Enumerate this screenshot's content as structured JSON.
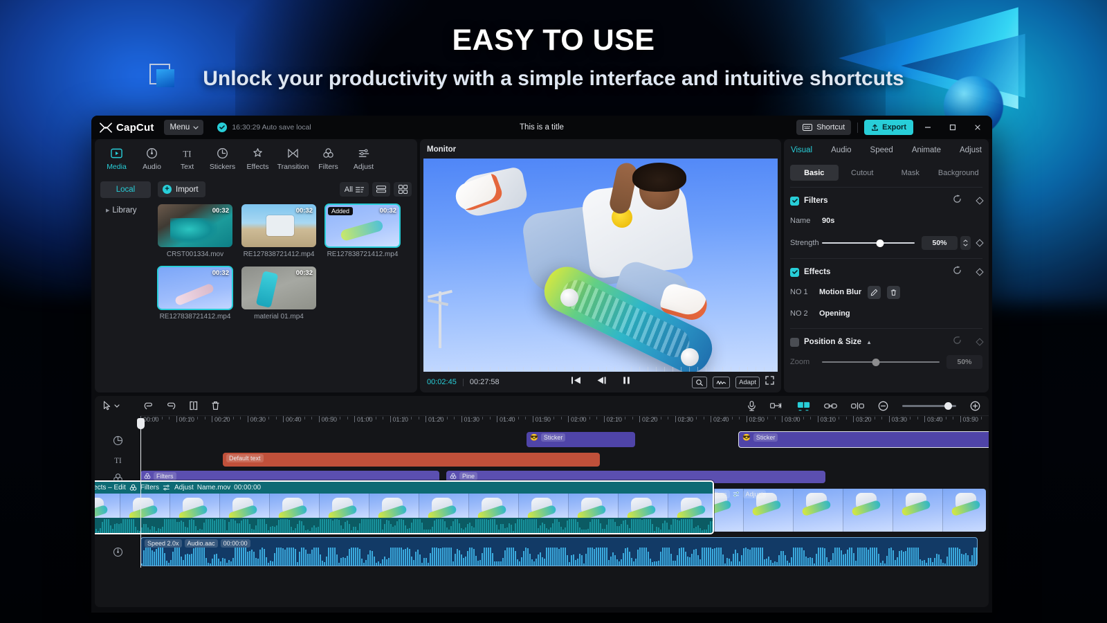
{
  "banner": {
    "headline": "EASY TO USE",
    "subhead": "Unlock your productivity with a simple interface and intuitive shortcuts"
  },
  "titlebar": {
    "brand": "CapCut",
    "menu_label": "Menu",
    "autosave": "16:30:29 Auto save local",
    "doc_title": "This is a title",
    "shortcut_label": "Shortcut",
    "export_label": "Export",
    "minimize": "–",
    "maximize": "□",
    "close": "✕"
  },
  "nav_tabs": [
    {
      "label": "Media",
      "icon": "media-icon",
      "active": true
    },
    {
      "label": "Audio",
      "icon": "audio-icon",
      "active": false
    },
    {
      "label": "Text",
      "icon": "text-icon",
      "active": false
    },
    {
      "label": "Stickers",
      "icon": "stickers-icon",
      "active": false
    },
    {
      "label": "Effects",
      "icon": "effects-icon",
      "active": false
    },
    {
      "label": "Transition",
      "icon": "transition-icon",
      "active": false
    },
    {
      "label": "Filters",
      "icon": "filters-icon",
      "active": false
    },
    {
      "label": "Adjust",
      "icon": "adjust-icon",
      "active": false
    }
  ],
  "media": {
    "sidebar": [
      {
        "label": "Local",
        "active": true
      },
      {
        "label": "Library",
        "active": false
      }
    ],
    "import_label": "Import",
    "filter_label": "All",
    "items": [
      {
        "name": "CRST001334.mov",
        "duration": "00:32",
        "badge": "",
        "selected": false,
        "art": "t1"
      },
      {
        "name": "RE127838721412.mp4",
        "duration": "00:32",
        "badge": "",
        "selected": false,
        "art": "t2"
      },
      {
        "name": "RE127838721412.mp4",
        "duration": "00:32",
        "badge": "Added",
        "selected": true,
        "art": "t3"
      },
      {
        "name": "RE127838721412.mp4",
        "duration": "00:32",
        "badge": "",
        "selected": true,
        "art": "t4"
      },
      {
        "name": "material 01.mp4",
        "duration": "00:32",
        "badge": "",
        "selected": false,
        "art": "t5"
      }
    ]
  },
  "monitor": {
    "title": "Monitor",
    "current_time": "00:02:45",
    "total_time": "00:27:58",
    "adapt_label": "Adapt"
  },
  "attributes": {
    "tabs": [
      {
        "label": "Visual",
        "active": true
      },
      {
        "label": "Audio",
        "active": false
      },
      {
        "label": "Speed",
        "active": false
      },
      {
        "label": "Animate",
        "active": false
      },
      {
        "label": "Adjust",
        "active": false
      }
    ],
    "segments": [
      {
        "label": "Basic",
        "active": true
      },
      {
        "label": "Cutout",
        "active": false
      },
      {
        "label": "Mask",
        "active": false
      },
      {
        "label": "Background",
        "active": false
      }
    ],
    "filters": {
      "title": "Filters",
      "enabled": true,
      "name_label": "Name",
      "name_value": "90s",
      "strength_label": "Strength",
      "strength_value": "50%"
    },
    "effects": {
      "title": "Effects",
      "enabled": true,
      "items": [
        {
          "no": "NO 1",
          "name": "Motion Blur",
          "has_actions": true
        },
        {
          "no": "NO 2",
          "name": "Opening",
          "has_actions": false
        }
      ]
    },
    "position_size": {
      "title": "Position & Size",
      "enabled": false,
      "zoom_label": "Zoom",
      "zoom_value": "50%"
    }
  },
  "timeline": {
    "ruler_ticks": [
      "00:00",
      "00:10",
      "00:20",
      "00:30",
      "00:40",
      "00:50",
      "01:00",
      "01:10",
      "01:20",
      "01:30",
      "01:40",
      "01:50",
      "02:00",
      "02:10",
      "02:20",
      "02:30",
      "02:40",
      "02:50",
      "03:00",
      "03:10",
      "03:20",
      "03:30",
      "03:40",
      "03:50"
    ],
    "track_headers": [
      "sticker-track-icon",
      "text-track-icon",
      "filter-track-icon",
      "video-track-icon",
      "audio-track-icon"
    ],
    "clips": {
      "stickers": [
        {
          "label": "Sticker",
          "icon": "sunglasses-emoji"
        },
        {
          "label": "Sticker",
          "icon": "sunglasses-emoji"
        }
      ],
      "text": [
        {
          "label": "Default text"
        }
      ],
      "filters": [
        {
          "label": "Filters",
          "icon": "filter-icon"
        },
        {
          "label": "Pine",
          "icon": "filter-icon"
        }
      ],
      "video_selected": {
        "effects_label": "Effects – Edit",
        "filters_label": "Filters",
        "adjust_label": "Adjust",
        "name": "Name.mov",
        "time": "00:00:00"
      },
      "video_right": {
        "filters_label": "Filters",
        "adjust_label": "Adjust"
      },
      "audio": {
        "speed_label": "Speed 2.0x",
        "name": "Audio.aac",
        "time": "00:00:00"
      }
    }
  },
  "colors": {
    "accent": "#28ced8",
    "panel": "#18191d",
    "window": "#0b0c0f",
    "text_clip": "#c0503a",
    "filter_clip": "#5b4fb0",
    "sticker_clip": "#4f44a8",
    "video_clip": "#0d6a74",
    "audio_clip": "#123a66"
  }
}
